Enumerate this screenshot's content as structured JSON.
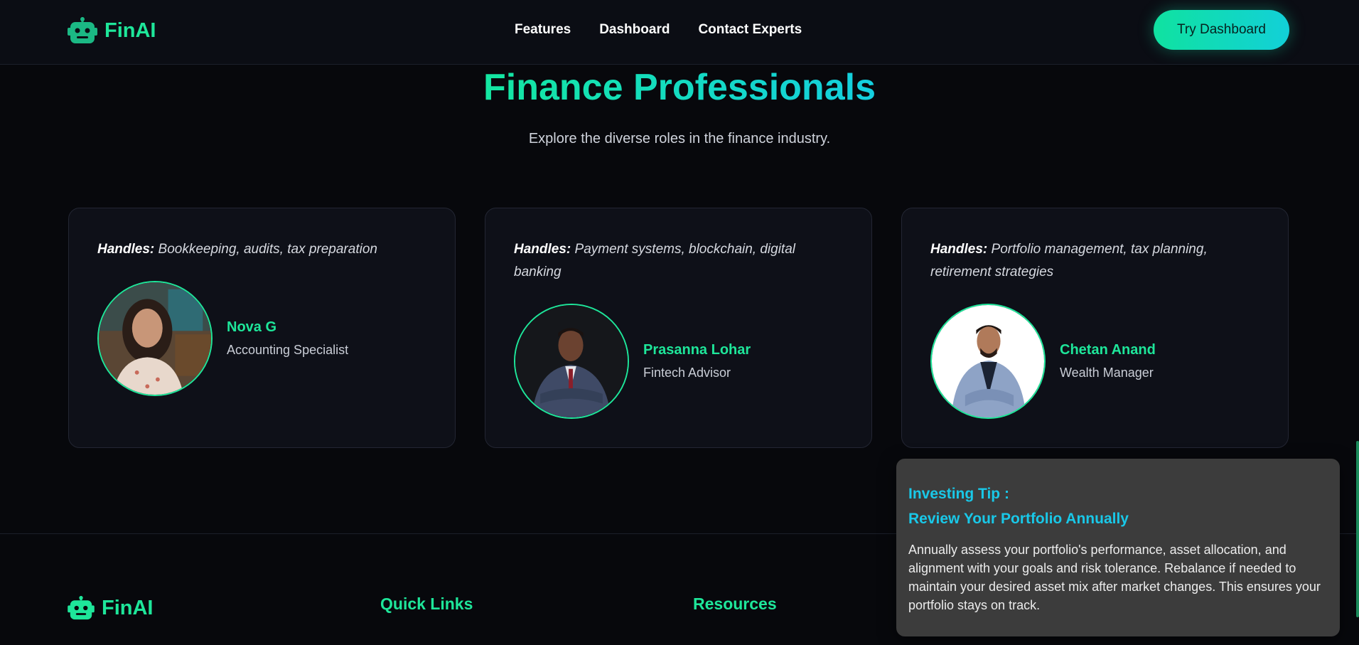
{
  "header": {
    "logo_text": "FinAI",
    "logo_icon": "robot-icon",
    "nav": [
      "Features",
      "Dashboard",
      "Contact Experts"
    ],
    "cta_label": "Try Dashboard"
  },
  "hero": {
    "title": "Finance Professionals",
    "subtitle": "Explore the diverse roles in the finance industry."
  },
  "cards": [
    {
      "handles_label": "Handles:",
      "handles_text": "Bookkeeping, audits, tax preparation",
      "name": "Nova G",
      "role": "Accounting Specialist"
    },
    {
      "handles_label": "Handles:",
      "handles_text": "Payment systems, blockchain, digital banking",
      "name": "Prasanna Lohar",
      "role": "Fintech Advisor"
    },
    {
      "handles_label": "Handles:",
      "handles_text": "Portfolio management, tax planning, retirement strategies",
      "name": "Chetan Anand",
      "role": "Wealth Manager"
    }
  ],
  "footer": {
    "logo_text": "FinAI",
    "quick_links_heading": "Quick Links",
    "resources_heading": "Resources"
  },
  "tip": {
    "label": "Investing Tip :",
    "title": "Review Your Portfolio Annually",
    "body": "Annually assess your portfolio's performance, asset allocation, and alignment with your goals and risk tolerance. Rebalance if needed to maintain your desired asset mix after market changes. This ensures your portfolio stays on track."
  },
  "colors": {
    "accent": "#1ee69a",
    "accent_cyan": "#19c8e8",
    "background": "#07080c",
    "card": "#0e1018",
    "tip_bg": "#3c3c3c"
  }
}
